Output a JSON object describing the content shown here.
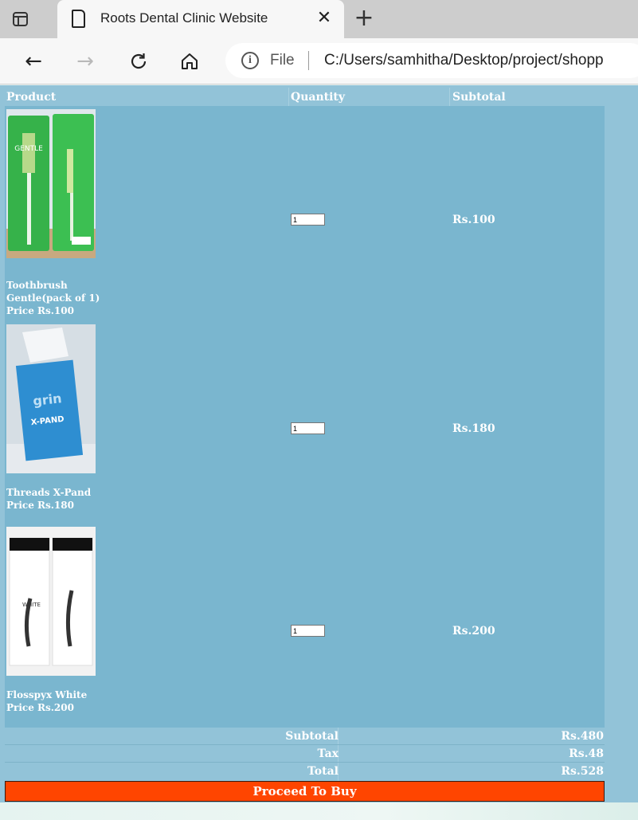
{
  "browser": {
    "tab_title": "Roots Dental Clinic Website",
    "address_scheme": "File",
    "address_url": "C:/Users/samhitha/Desktop/project/shopp"
  },
  "cart": {
    "headers": {
      "product": "Product",
      "quantity": "Quantity",
      "subtotal": "Subtotal"
    },
    "items": [
      {
        "name_line1": "Toothbrush",
        "name_line2": "Gentle(pack of 1)",
        "price": "Price Rs.100",
        "quantity": "1",
        "subtotal": "Rs.100",
        "image_label": "GENTLE"
      },
      {
        "name_line1": "Threads X-Pand",
        "name_line2": "",
        "price": "Price Rs.180",
        "quantity": "1",
        "subtotal": "Rs.180",
        "image_label": "X-PAND"
      },
      {
        "name_line1": "Flosspyx White",
        "name_line2": "",
        "price": "Price Rs.200",
        "quantity": "1",
        "subtotal": "Rs.200",
        "image_label": "WHITE"
      }
    ]
  },
  "summary": {
    "subtotal_label": "Subtotal",
    "subtotal_value": "Rs.480",
    "tax_label": "Tax",
    "tax_value": "Rs.48",
    "total_label": "Total",
    "total_value": "Rs.528"
  },
  "actions": {
    "buy_label": "Proceed To Buy"
  },
  "colors": {
    "table_bg": "#7ab6cf",
    "header_bg": "#92c3d8",
    "buy_button": "#ff4500"
  }
}
